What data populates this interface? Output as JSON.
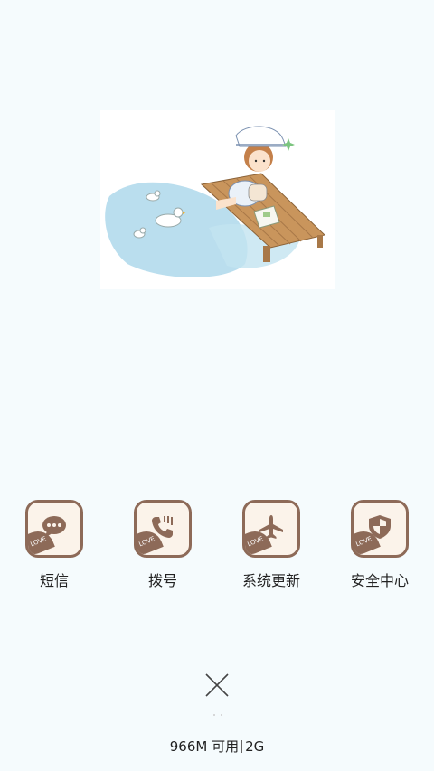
{
  "apps": [
    {
      "name": "短信",
      "icon": "message-icon",
      "badge": "LOVE"
    },
    {
      "name": "拨号",
      "icon": "phone-icon",
      "badge": "LOVE"
    },
    {
      "name": "系统更新",
      "icon": "airplane-icon",
      "badge": "LOVE"
    },
    {
      "name": "安全中心",
      "icon": "shield-icon",
      "badge": "LOVE"
    }
  ],
  "memory": {
    "available": "966M 可用",
    "total": "2G"
  },
  "colors": {
    "background": "#f5fbfd",
    "icon_border": "#8d6a58",
    "icon_fill": "#fbf3ea",
    "water": "#a9d6ea",
    "deck": "#c9955c"
  }
}
